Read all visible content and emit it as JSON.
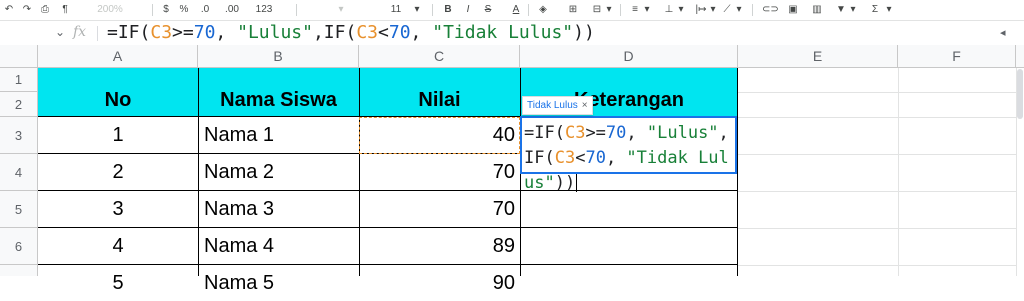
{
  "toolbar": {
    "zoom": "200%",
    "currency": "$",
    "percent": "%",
    "decrease_decimal": ".0",
    "increase_decimal": ".00",
    "number_format": "123",
    "font_size": "11",
    "bold": "B",
    "italic": "I",
    "strikethrough": "S",
    "text_color": "A",
    "functions": "Σ"
  },
  "formula_bar": {
    "fx": "fx",
    "cell_ref_arrow": "⌄",
    "tokens": [
      {
        "t": "=IF(",
        "c": "plain"
      },
      {
        "t": "C3",
        "c": "ref"
      },
      {
        "t": ">=",
        "c": "plain"
      },
      {
        "t": "70",
        "c": "num"
      },
      {
        "t": ", ",
        "c": "plain"
      },
      {
        "t": "\"Lulus\"",
        "c": "str"
      },
      {
        "t": ",IF(",
        "c": "plain"
      },
      {
        "t": "C3",
        "c": "ref"
      },
      {
        "t": "<",
        "c": "plain"
      },
      {
        "t": "70",
        "c": "num"
      },
      {
        "t": ", ",
        "c": "plain"
      },
      {
        "t": "\"Tidak Lulus\"",
        "c": "str"
      },
      {
        "t": "))",
        "c": "plain"
      }
    ]
  },
  "columns": [
    "A",
    "B",
    "C",
    "D",
    "E",
    "F"
  ],
  "rows": [
    "1",
    "2",
    "3",
    "4",
    "5",
    "6"
  ],
  "table": {
    "headers": [
      "No",
      "Nama Siswa",
      "Nilai",
      "Keterangan"
    ],
    "data": [
      {
        "no": "1",
        "nama": "Nama 1",
        "nilai": "40"
      },
      {
        "no": "2",
        "nama": "Nama 2",
        "nilai": "70"
      },
      {
        "no": "3",
        "nama": "Nama 3",
        "nilai": "70"
      },
      {
        "no": "4",
        "nama": "Nama 4",
        "nilai": "89"
      },
      {
        "no": "5",
        "nama": "Nama 5",
        "nilai": "90"
      }
    ]
  },
  "cell_editor": {
    "tokens": [
      {
        "t": "=IF(",
        "c": "plain"
      },
      {
        "t": "C3",
        "c": "ref"
      },
      {
        "t": ">=",
        "c": "plain"
      },
      {
        "t": "70",
        "c": "num"
      },
      {
        "t": ", ",
        "c": "plain"
      },
      {
        "t": "\"Lulus\"",
        "c": "str"
      },
      {
        "t": ",IF(",
        "c": "plain"
      },
      {
        "t": "C3",
        "c": "ref"
      },
      {
        "t": "<",
        "c": "plain"
      },
      {
        "t": "70",
        "c": "num"
      },
      {
        "t": ", ",
        "c": "plain"
      },
      {
        "t": "\"Tidak Lulus\"",
        "c": "str"
      },
      {
        "t": "))",
        "c": "plain"
      }
    ]
  },
  "result_chip": {
    "label": "Tidak Lulus",
    "close": "×"
  },
  "colors": {
    "header_band": "#00e5f0",
    "selection": "#1a73e8",
    "reference": "#e8912d",
    "number": "#1967d2",
    "string": "#188038"
  }
}
